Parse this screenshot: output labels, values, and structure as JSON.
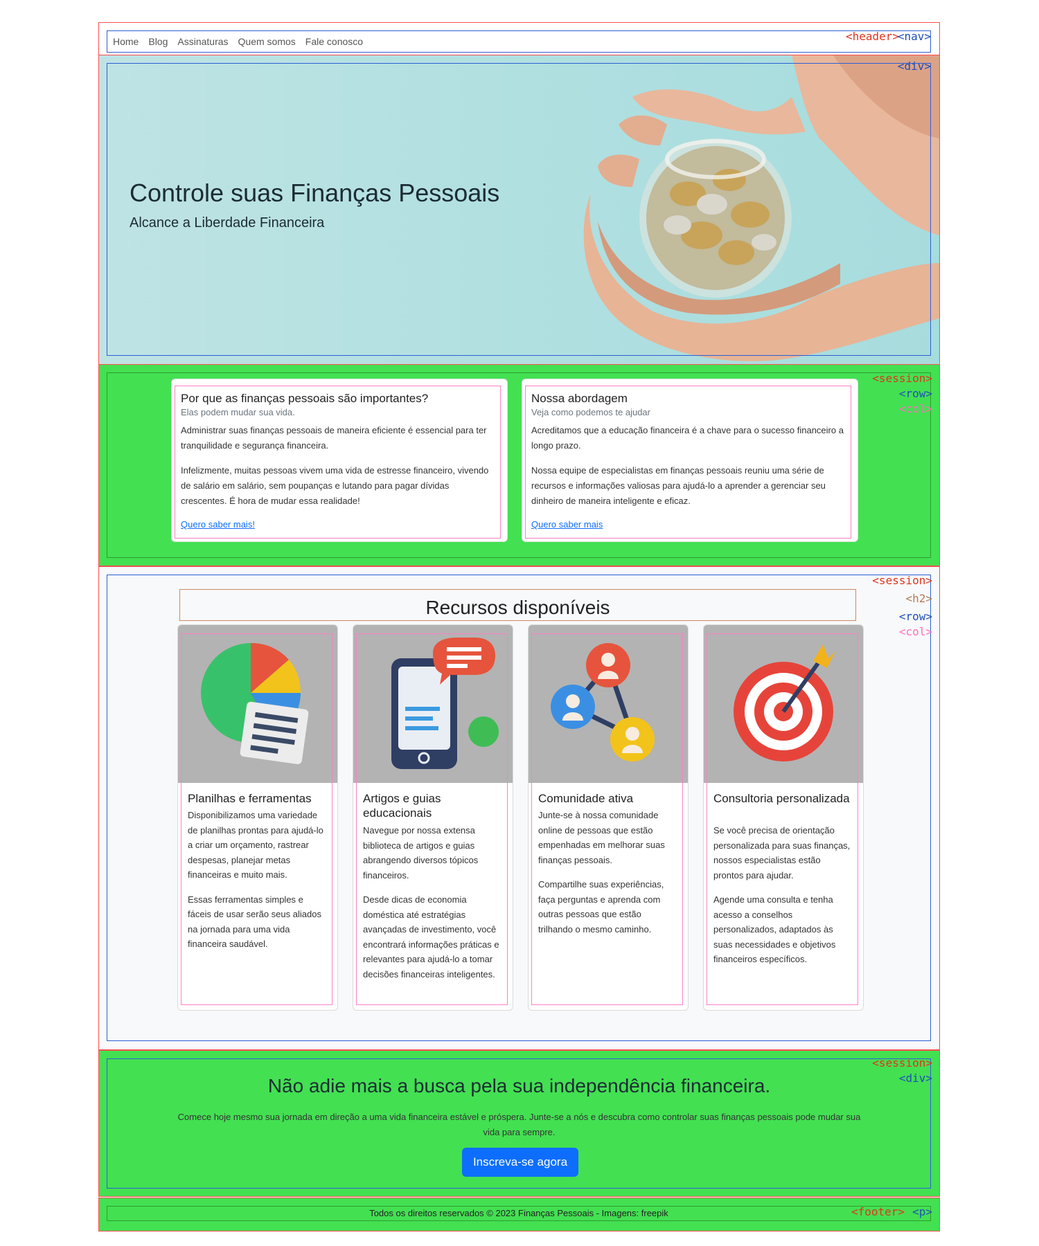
{
  "nav": {
    "items": [
      "Home",
      "Blog",
      "Assinaturas",
      "Quem somos",
      "Fale conosco"
    ]
  },
  "debug_tags": {
    "header": "<header>",
    "nav": "<nav>",
    "div": "<div>",
    "session": "<session>",
    "row": "<row>",
    "col": "<col>",
    "h2": "<h2>",
    "footer": "<footer>",
    "p": "<p>"
  },
  "hero": {
    "title": "Controle suas Finanças Pessoais",
    "subtitle": "Alcance a Liberdade Financeira"
  },
  "why": {
    "cards": [
      {
        "title": "Por que as finanças pessoais são importantes?",
        "subtitle": "Elas podem mudar sua vida.",
        "paragraphs": [
          "Administrar suas finanças pessoais de maneira eficiente é essencial para ter tranquilidade e segurança financeira.",
          "Infelizmente, muitas pessoas vivem uma vida de estresse financeiro, vivendo de salário em salário, sem poupanças e lutando para pagar dívidas crescentes. É hora de mudar essa realidade!"
        ],
        "link": "Quero saber mais!"
      },
      {
        "title": "Nossa abordagem",
        "subtitle": "Veja como podemos te ajudar",
        "paragraphs": [
          "Acreditamos que a educação financeira é a chave para o sucesso financeiro a longo prazo.",
          "Nossa equipe de especialistas em finanças pessoais reuniu uma série de recursos e informações valiosas para ajudá-lo a aprender a gerenciar seu dinheiro de maneira inteligente e eficaz."
        ],
        "link": "Quero saber mais"
      }
    ]
  },
  "resources": {
    "heading": "Recursos disponíveis",
    "cards": [
      {
        "icon": "pie-chart-icon",
        "title": "Planilhas e ferramentas",
        "paragraphs": [
          "Disponibilizamos uma variedade de planilhas prontas para ajudá-lo a criar um orçamento, rastrear despesas, planejar metas financeiras e muito mais.",
          "Essas ferramentas simples e fáceis de usar serão seus aliados na jornada para uma vida financeira saudável."
        ]
      },
      {
        "icon": "phone-chat-icon",
        "title": "Artigos e guias educacionais",
        "paragraphs": [
          "Navegue por nossa extensa biblioteca de artigos e guias abrangendo diversos tópicos financeiros.",
          "Desde dicas de economia doméstica até estratégias avançadas de investimento, você encontrará informações práticas e relevantes para ajudá-lo a tomar decisões financeiras inteligentes."
        ]
      },
      {
        "icon": "community-network-icon",
        "title": "Comunidade ativa",
        "paragraphs": [
          "Junte-se à nossa comunidade online de pessoas que estão empenhadas em melhorar suas finanças pessoais.",
          "Compartilhe suas experiências, faça perguntas e aprenda com outras pessoas que estão trilhando o mesmo caminho."
        ]
      },
      {
        "icon": "target-dart-icon",
        "title": "Consultoria personalizada",
        "paragraphs": [
          "Se você precisa de orientação personalizada para suas finanças, nossos especialistas estão prontos para ajudar.",
          "Agende uma consulta e tenha acesso a conselhos personalizados, adaptados às suas necessidades e objetivos financeiros específicos."
        ]
      }
    ]
  },
  "cta": {
    "heading": "Não adie mais a busca pela sua independência financeira.",
    "text": "Comece hoje mesmo sua jornada em direção a uma vida financeira estável e próspera. Junte-se a nós e descubra como controlar suas finanças pessoais pode mudar sua vida para sempre.",
    "button": "Inscreva-se agora"
  },
  "footer": {
    "text": "Todos os direitos reservados © 2023 Finanças Pessoais - Imagens: freepik"
  },
  "colors": {
    "section_green": "#43e052",
    "button_blue": "#0d6efd",
    "hero_bg": "#b2e0e1"
  }
}
